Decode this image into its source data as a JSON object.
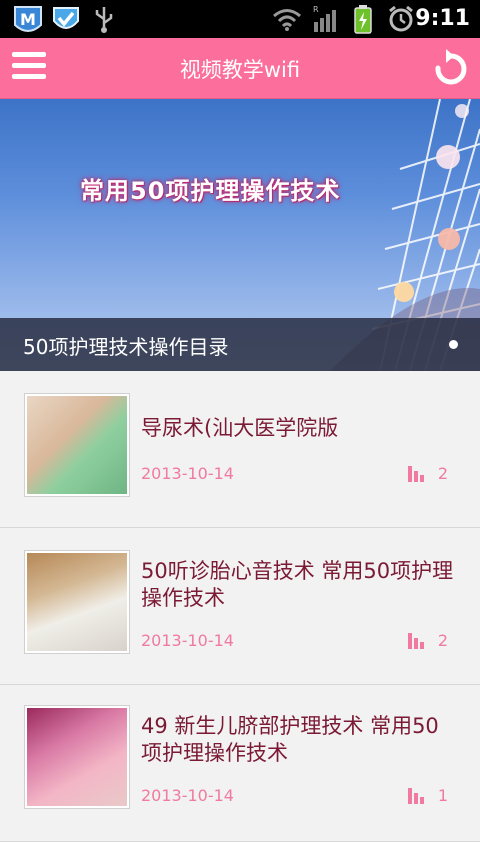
{
  "status_bar": {
    "time": "9:11",
    "icons": [
      "m-app-icon",
      "shield-check-icon",
      "usb-icon",
      "wifi-icon",
      "signal-icon",
      "battery-charging-icon",
      "alarm-icon"
    ]
  },
  "app_bar": {
    "title": "视频教学wifi",
    "menu_icon": "menu-icon",
    "refresh_icon": "refresh-icon",
    "background": "#fc6e9b"
  },
  "banner": {
    "heading": "常用50项护理操作技术",
    "caption": "50项护理技术操作目录"
  },
  "list": [
    {
      "title": "导尿术(汕大医学院版",
      "date": "2013-10-14",
      "count": "2"
    },
    {
      "title": "50听诊胎心音技术 常用50项护理操作技术",
      "date": "2013-10-14",
      "count": "2"
    },
    {
      "title": "49 新生儿脐部护理技术 常用50项护理操作技术",
      "date": "2013-10-14",
      "count": "1"
    }
  ]
}
